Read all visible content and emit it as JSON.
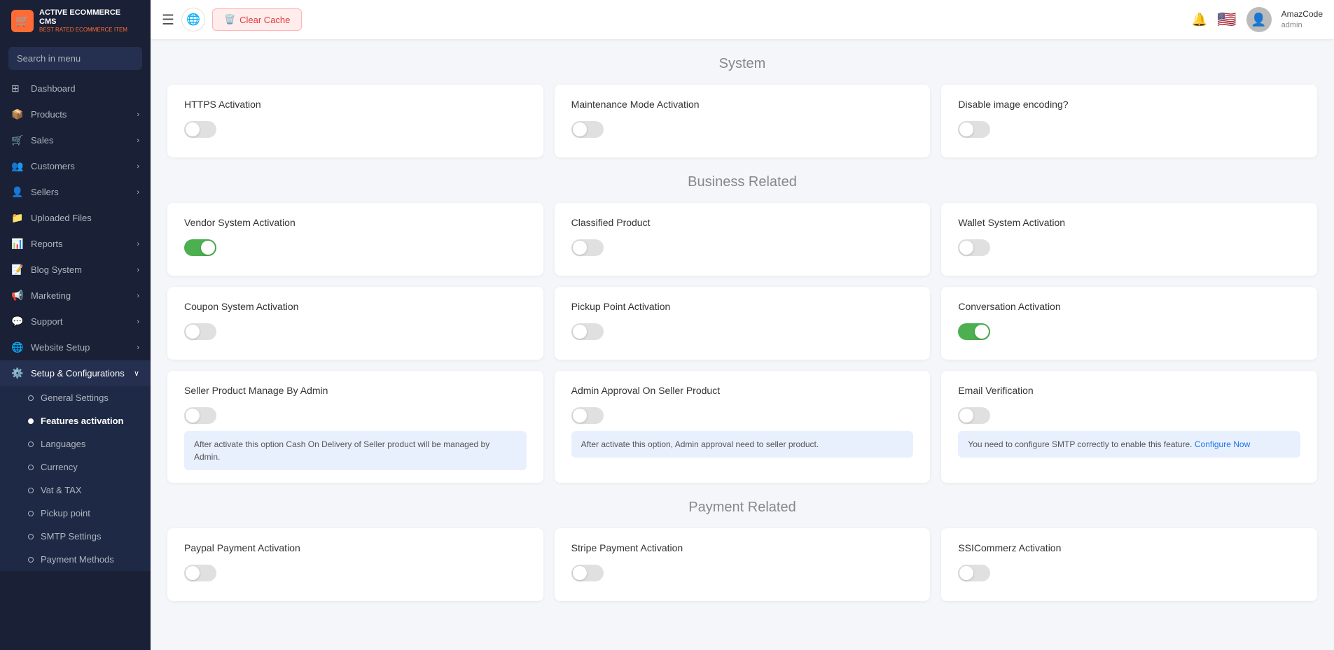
{
  "app": {
    "name": "ACTIVE ECOMMERCE CMS",
    "tagline": "BEST RATED ECOMMERCE ITEM"
  },
  "topbar": {
    "clear_cache_label": "Clear Cache",
    "user_name": "AmazCode",
    "user_role": "admin"
  },
  "search": {
    "placeholder": "Search in menu"
  },
  "sidebar": {
    "items": [
      {
        "id": "dashboard",
        "label": "Dashboard",
        "icon": "⊞",
        "has_arrow": false
      },
      {
        "id": "products",
        "label": "Products",
        "icon": "📦",
        "has_arrow": true
      },
      {
        "id": "sales",
        "label": "Sales",
        "icon": "🛒",
        "has_arrow": true
      },
      {
        "id": "customers",
        "label": "Customers",
        "icon": "👥",
        "has_arrow": true
      },
      {
        "id": "sellers",
        "label": "Sellers",
        "icon": "👤",
        "has_arrow": true
      },
      {
        "id": "uploaded-files",
        "label": "Uploaded Files",
        "icon": "📁",
        "has_arrow": false
      },
      {
        "id": "reports",
        "label": "Reports",
        "icon": "📊",
        "has_arrow": true
      },
      {
        "id": "blog-system",
        "label": "Blog System",
        "icon": "📝",
        "has_arrow": true
      },
      {
        "id": "marketing",
        "label": "Marketing",
        "icon": "📢",
        "has_arrow": true
      },
      {
        "id": "support",
        "label": "Support",
        "icon": "💬",
        "has_arrow": true
      },
      {
        "id": "website-setup",
        "label": "Website Setup",
        "icon": "🌐",
        "has_arrow": true
      },
      {
        "id": "setup-configurations",
        "label": "Setup & Configurations",
        "icon": "⚙️",
        "has_arrow": true,
        "active": true
      }
    ],
    "sub_items": [
      {
        "id": "general-settings",
        "label": "General Settings",
        "active": false
      },
      {
        "id": "features-activation",
        "label": "Features activation",
        "active": true
      },
      {
        "id": "languages",
        "label": "Languages",
        "active": false
      },
      {
        "id": "currency",
        "label": "Currency",
        "active": false
      },
      {
        "id": "vat-tax",
        "label": "Vat & TAX",
        "active": false
      },
      {
        "id": "pickup-point",
        "label": "Pickup point",
        "active": false
      },
      {
        "id": "smtp-settings",
        "label": "SMTP Settings",
        "active": false
      },
      {
        "id": "payment-methods",
        "label": "Payment Methods",
        "active": false
      }
    ]
  },
  "sections": [
    {
      "id": "system",
      "title": "System",
      "cards": [
        {
          "id": "https-activation",
          "title": "HTTPS Activation",
          "on": false,
          "info": null
        },
        {
          "id": "maintenance-mode",
          "title": "Maintenance Mode Activation",
          "on": false,
          "info": null
        },
        {
          "id": "disable-image-encoding",
          "title": "Disable image encoding?",
          "on": false,
          "info": null
        }
      ]
    },
    {
      "id": "business-related",
      "title": "Business Related",
      "cards": [
        {
          "id": "vendor-system",
          "title": "Vendor System Activation",
          "on": true,
          "info": null
        },
        {
          "id": "classified-product",
          "title": "Classified Product",
          "on": false,
          "info": null
        },
        {
          "id": "wallet-system",
          "title": "Wallet System Activation",
          "on": false,
          "info": null
        },
        {
          "id": "coupon-system",
          "title": "Coupon System Activation",
          "on": false,
          "info": null
        },
        {
          "id": "pickup-point-activation",
          "title": "Pickup Point Activation",
          "on": false,
          "info": null
        },
        {
          "id": "conversation-activation",
          "title": "Conversation Activation",
          "on": true,
          "info": null
        },
        {
          "id": "seller-product-manage",
          "title": "Seller Product Manage By Admin",
          "on": false,
          "info": "After activate this option Cash On Delivery of Seller product will be managed by Admin."
        },
        {
          "id": "admin-approval-seller",
          "title": "Admin Approval On Seller Product",
          "on": false,
          "info": "After activate this option, Admin approval need to seller product."
        },
        {
          "id": "email-verification",
          "title": "Email Verification",
          "on": false,
          "info": "You need to configure SMTP correctly to enable this feature. Configure Now",
          "has_link": true
        }
      ]
    },
    {
      "id": "payment-related",
      "title": "Payment Related",
      "cards": [
        {
          "id": "paypal",
          "title": "Paypal Payment Activation",
          "on": false,
          "info": null
        },
        {
          "id": "stripe",
          "title": "Stripe Payment Activation",
          "on": false,
          "info": null
        },
        {
          "id": "sslcommerz",
          "title": "SSICommerz Activation",
          "on": false,
          "info": null
        }
      ]
    }
  ]
}
